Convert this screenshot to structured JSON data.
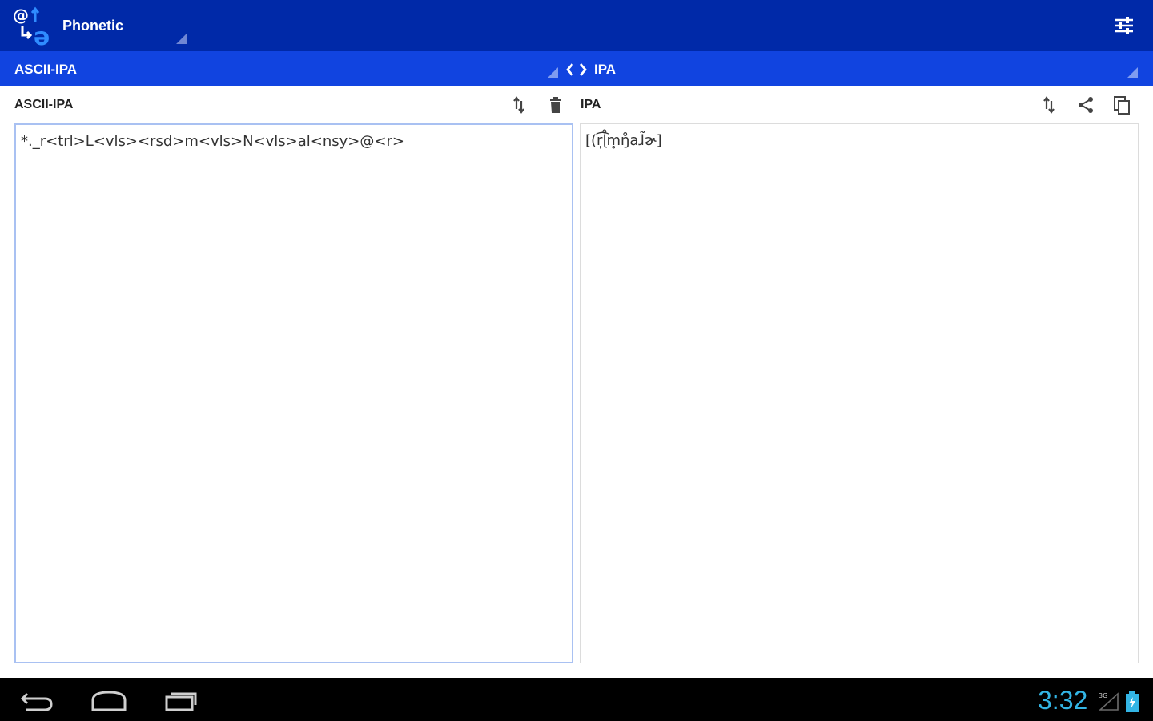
{
  "action_bar": {
    "title": "Phonetic",
    "icons": {
      "app": "app-logo-icon",
      "settings": "sliders-settings-icon"
    },
    "colors": {
      "background": "#0029a8"
    }
  },
  "lang_bar": {
    "from_label": "ASCII-IPA",
    "to_label": "IPA",
    "icons": {
      "swap": "swap-icon"
    },
    "colors": {
      "background": "#1144e0"
    }
  },
  "source_panel": {
    "label": "ASCII-IPA",
    "text": "*._r<trl>L<vls><rsd>m<vls>N<vls>al<nsy>@<r>",
    "icons": [
      "transliterate-icon",
      "trash-icon"
    ]
  },
  "result_panel": {
    "label": "IPA",
    "text": "[(r̩͡ɭ̊m̥ŋ̊aɺ̃ɚ]",
    "icons": [
      "transliterate-icon",
      "share-icon",
      "copy-icon"
    ]
  },
  "system_bar": {
    "clock": "3:32",
    "signal_superscript": "3G",
    "icons": [
      "back-icon",
      "home-icon",
      "recent-apps-icon",
      "signal-icon",
      "battery-icon"
    ],
    "colors": {
      "clock": "#33b5e5"
    }
  }
}
